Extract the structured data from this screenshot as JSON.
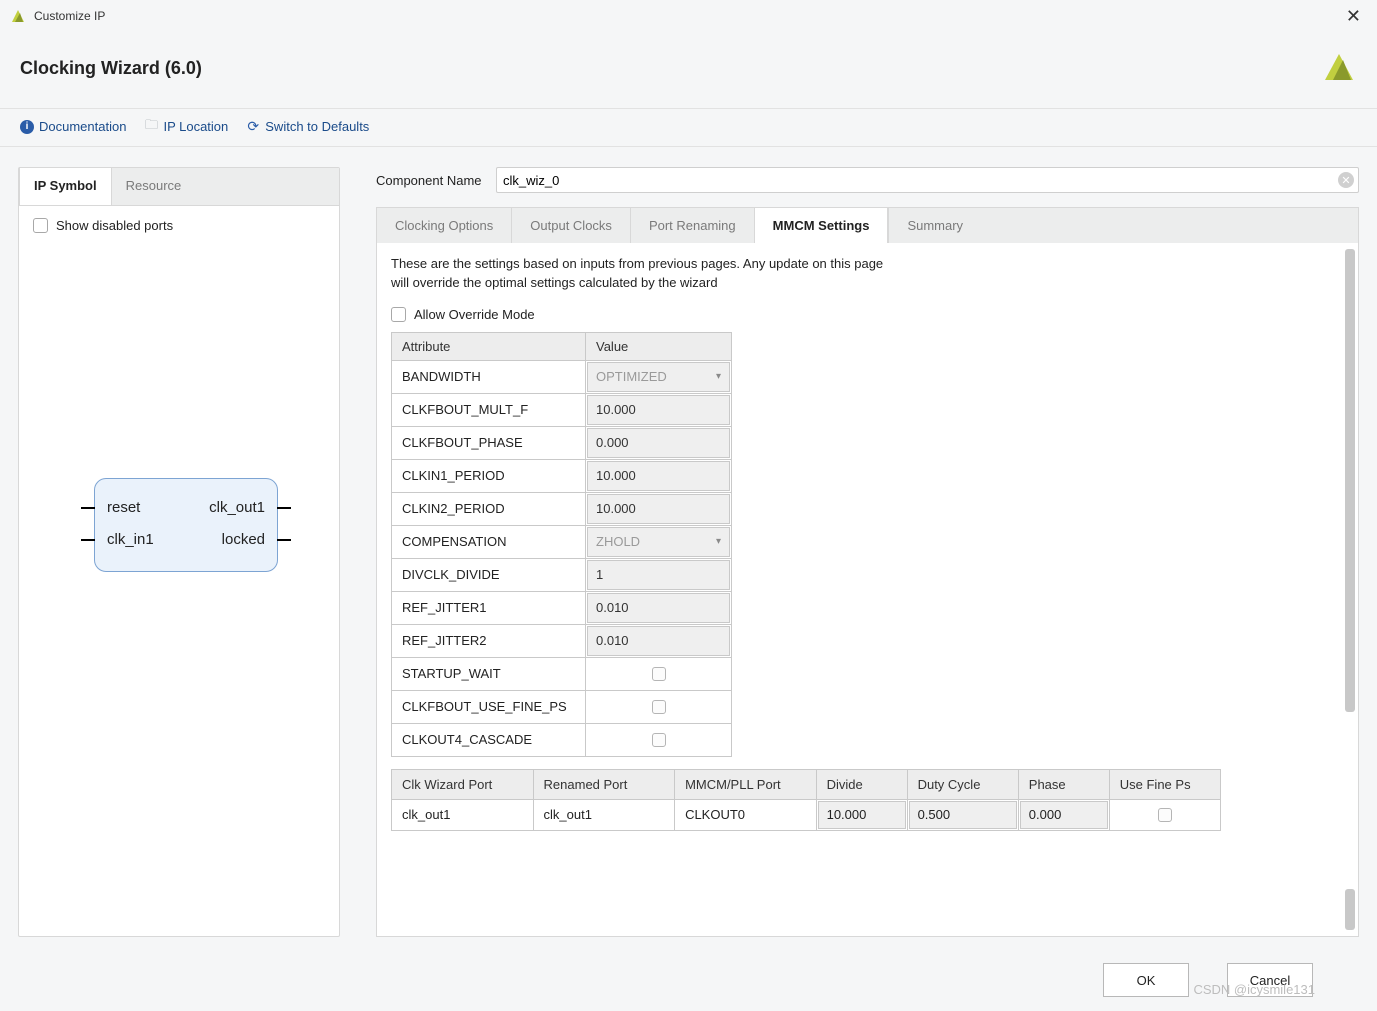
{
  "window": {
    "title": "Customize IP",
    "close": "✕"
  },
  "header": {
    "title": "Clocking Wizard (6.0)"
  },
  "toolbar": {
    "documentation": "Documentation",
    "ip_location": "IP Location",
    "switch_defaults": "Switch to Defaults"
  },
  "left": {
    "tabs": {
      "symbol": "IP Symbol",
      "resource": "Resource"
    },
    "show_disabled": "Show disabled ports",
    "ports": {
      "reset": "reset",
      "clk_in1": "clk_in1",
      "clk_out1": "clk_out1",
      "locked": "locked"
    }
  },
  "comp": {
    "label": "Component Name",
    "value": "clk_wiz_0"
  },
  "rtabs": {
    "clocking": "Clocking Options",
    "output": "Output Clocks",
    "rename": "Port Renaming",
    "mmcm": "MMCM Settings",
    "summary": "Summary"
  },
  "desc": {
    "l1": "These are the settings based on inputs from previous pages. Any update on this page",
    "l2": "will override the optimal settings calculated by the wizard"
  },
  "override": "Allow Override Mode",
  "attrhead": {
    "attr": "Attribute",
    "val": "Value"
  },
  "attrs": [
    {
      "a": "BANDWIDTH",
      "v": "OPTIMIZED",
      "type": "sel",
      "dim": true
    },
    {
      "a": "CLKFBOUT_MULT_F",
      "v": "10.000",
      "type": "txt"
    },
    {
      "a": "CLKFBOUT_PHASE",
      "v": "0.000",
      "type": "txt"
    },
    {
      "a": "CLKIN1_PERIOD",
      "v": "10.000",
      "type": "txt"
    },
    {
      "a": "CLKIN2_PERIOD",
      "v": "10.000",
      "type": "txt"
    },
    {
      "a": "COMPENSATION",
      "v": "ZHOLD",
      "type": "sel",
      "dim": true
    },
    {
      "a": "DIVCLK_DIVIDE",
      "v": "1",
      "type": "txt"
    },
    {
      "a": "REF_JITTER1",
      "v": "0.010",
      "type": "txt"
    },
    {
      "a": "REF_JITTER2",
      "v": "0.010",
      "type": "txt"
    },
    {
      "a": "STARTUP_WAIT",
      "v": "",
      "type": "chk"
    },
    {
      "a": "CLKFBOUT_USE_FINE_PS",
      "v": "",
      "type": "chk"
    },
    {
      "a": "CLKOUT4_CASCADE",
      "v": "",
      "type": "chk"
    }
  ],
  "portshead": {
    "wiz": "Clk Wizard Port",
    "ren": "Renamed Port",
    "mmcm": "MMCM/PLL Port",
    "div": "Divide",
    "duty": "Duty Cycle",
    "phase": "Phase",
    "fine": "Use Fine Ps"
  },
  "ports": [
    {
      "wiz": "clk_out1",
      "ren": "clk_out1",
      "mmcm": "CLKOUT0",
      "div": "10.000",
      "duty": "0.500",
      "phase": "0.000"
    }
  ],
  "footer": {
    "ok": "OK",
    "cancel": "Cancel"
  },
  "watermark": "CSDN @icysmile131"
}
